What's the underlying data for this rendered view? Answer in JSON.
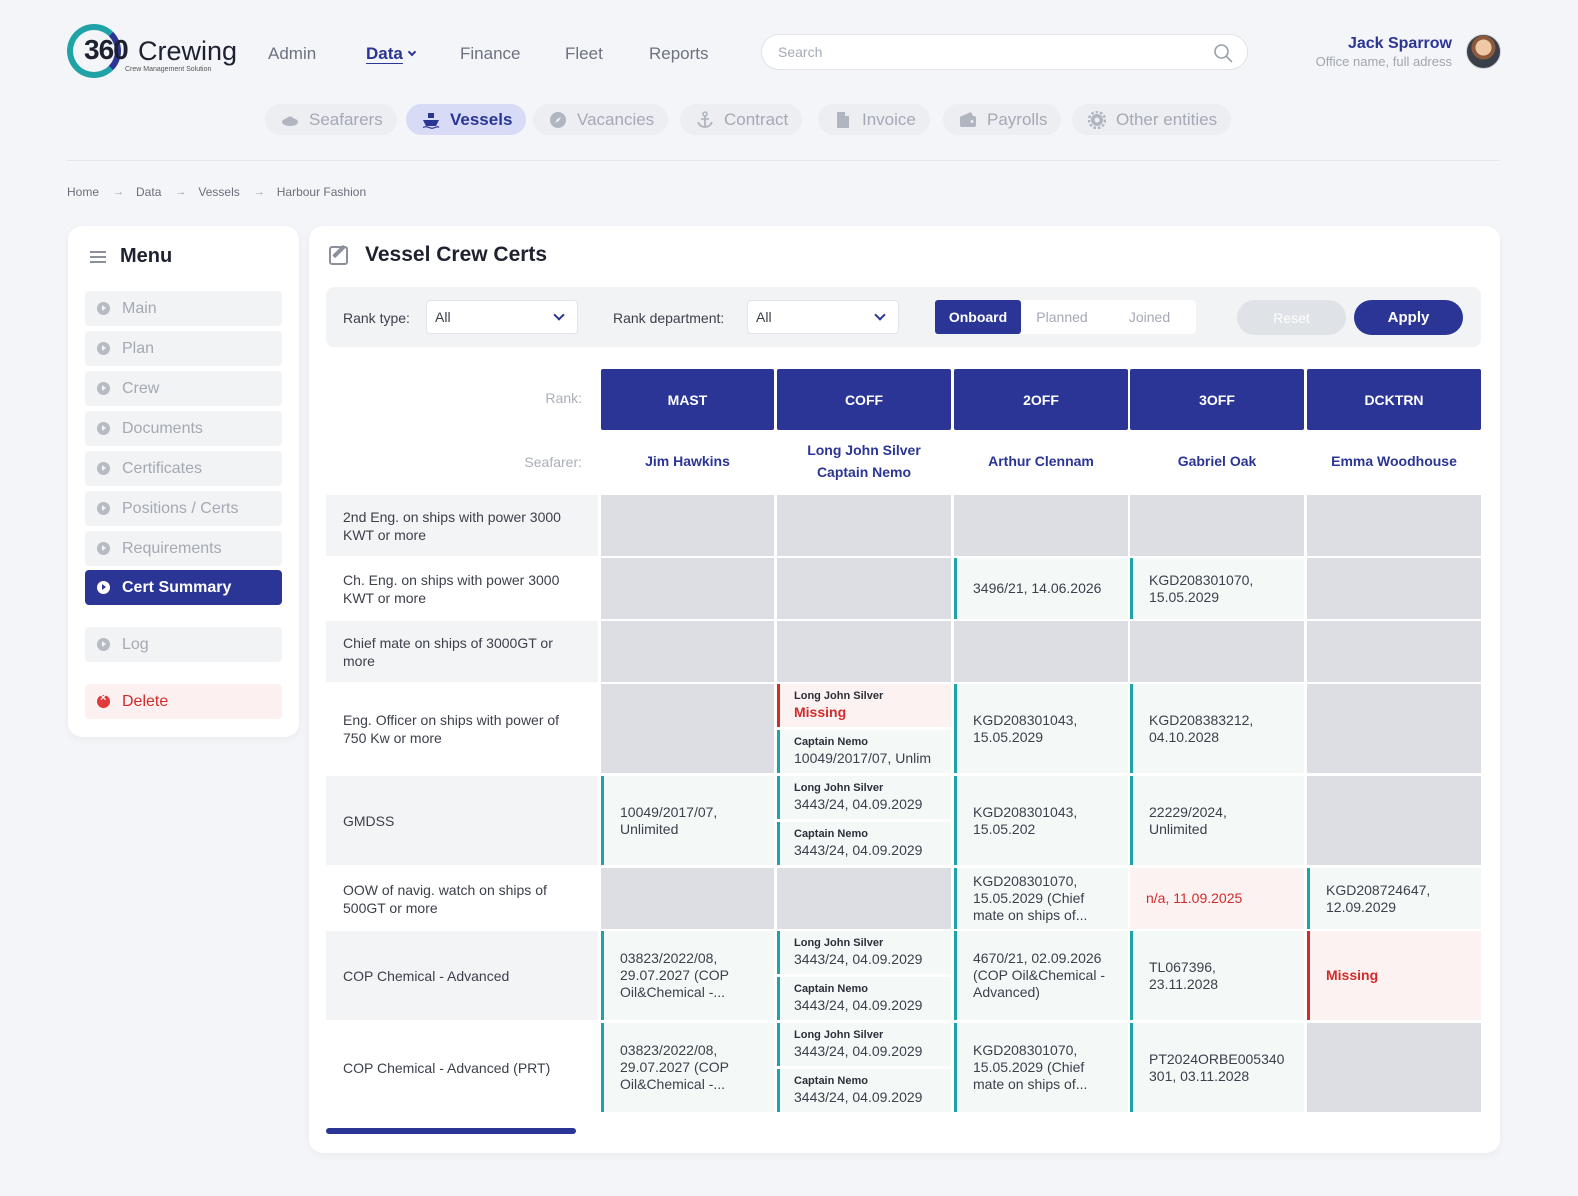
{
  "app": {
    "logo_number": "360",
    "logo_name": "Crewing",
    "logo_tagline": "Crew Management Solution"
  },
  "nav": {
    "admin": "Admin",
    "data": "Data",
    "finance": "Finance",
    "fleet": "Fleet",
    "reports": "Reports"
  },
  "search": {
    "placeholder": "Search"
  },
  "user": {
    "name": "Jack Sparrow",
    "office": "Office name, full adress"
  },
  "entity_tabs": {
    "seafarers": "Seafarers",
    "vessels": "Vessels",
    "vacancies": "Vacancies",
    "contract": "Contract",
    "invoice": "Invoice",
    "payrolls": "Payrolls",
    "other": "Other entities"
  },
  "breadcrumb": [
    "Home",
    "Data",
    "Vessels",
    "Harbour Fashion"
  ],
  "menu": {
    "title": "Menu",
    "items": [
      "Main",
      "Plan",
      "Crew",
      "Documents",
      "Certificates",
      "Positions / Certs",
      "Requirements",
      "Cert Summary"
    ],
    "log": "Log",
    "delete": "Delete"
  },
  "panel": {
    "title": "Vessel Crew Certs",
    "filters": {
      "rank_type_label": "Rank type:",
      "rank_type_value": "All",
      "rank_dept_label": "Rank department:",
      "rank_dept_value": "All",
      "segments": [
        "Onboard",
        "Planned",
        "Joined"
      ],
      "reset": "Reset",
      "apply": "Apply"
    },
    "rank_label": "Rank:",
    "seafarer_label": "Seafarer:",
    "ranks": [
      "MAST",
      "COFF",
      "2OFF",
      "3OFF",
      "DCKTRN"
    ],
    "seafarers": {
      "mast": "Jim Hawkins",
      "coff_1": "Long John Silver",
      "coff_2": "Captain Nemo",
      "off2": "Arthur Clennam",
      "off3": "Gabriel Oak",
      "dcktrn": "Emma Woodhouse"
    },
    "rows": {
      "r1": "2nd Eng. on ships with power 3000 KWT or more",
      "r2": "Ch. Eng. on ships with power 3000 KWT or more",
      "r3": "Chief mate on ships of 3000GT or more",
      "r4": "Eng. Officer on ships with power of 750 Kw or more",
      "r5": "GMDSS",
      "r6": "OOW of navig. watch on ships of 500GT or more",
      "r7": "COP Chemical - Advanced",
      "r8": "COP Chemical - Advanced (PRT)"
    },
    "cells": {
      "r2_off2": "3496/21, 14.06.2026",
      "r2_off3": "KGD208301070, 15.05.2029",
      "r4_coff_a_name": "Long John Silver",
      "r4_coff_a_val": "Missing",
      "r4_coff_b_name": "Captain Nemo",
      "r4_coff_b_val": "10049/2017/07, Unlim",
      "r4_off2": "KGD208301043, 15.05.2029",
      "r4_off3": "KGD208383212, 04.10.2028",
      "r5_mast": "10049/2017/07, Unlimited",
      "r5_coff_a_name": "Long John Silver",
      "r5_coff_a_val": "3443/24, 04.09.2029",
      "r5_coff_b_name": "Captain Nemo",
      "r5_coff_b_val": "3443/24, 04.09.2029",
      "r5_off2": "KGD208301043, 15.05.202",
      "r5_off3": "22229/2024, Unlimited",
      "r6_off2": "KGD208301070, 15.05.2029 (Chief mate on ships of...",
      "r6_off3": "n/a, 11.09.2025",
      "r6_dcktrn": "KGD208724647, 12.09.2029",
      "r7_mast": "03823/2022/08, 29.07.2027 (COP Oil&Chemical -...",
      "r7_coff_a_name": "Long John Silver",
      "r7_coff_a_val": "3443/24, 04.09.2029",
      "r7_coff_b_name": "Captain Nemo",
      "r7_coff_b_val": "3443/24, 04.09.2029",
      "r7_off2": "4670/21, 02.09.2026 (COP Oil&Chemical - Advanced)",
      "r7_off3": "TL067396, 23.11.2028",
      "r7_dcktrn": "Missing",
      "r8_mast": "03823/2022/08, 29.07.2027 (COP Oil&Chemical -...",
      "r8_coff_a_name": "Long John Silver",
      "r8_coff_a_val": "3443/24, 04.09.2029",
      "r8_coff_b_name": "Captain Nemo",
      "r8_coff_b_val": "3443/24, 04.09.2029",
      "r8_off2": "KGD208301070, 15.05.2029 (Chief mate on ships of...",
      "r8_off3": "PT2024ORBE005340 301, 03.11.2028"
    }
  },
  "colors": {
    "primary": "#2b3596",
    "teal": "#1fa3a6",
    "danger": "#d12c2c"
  }
}
